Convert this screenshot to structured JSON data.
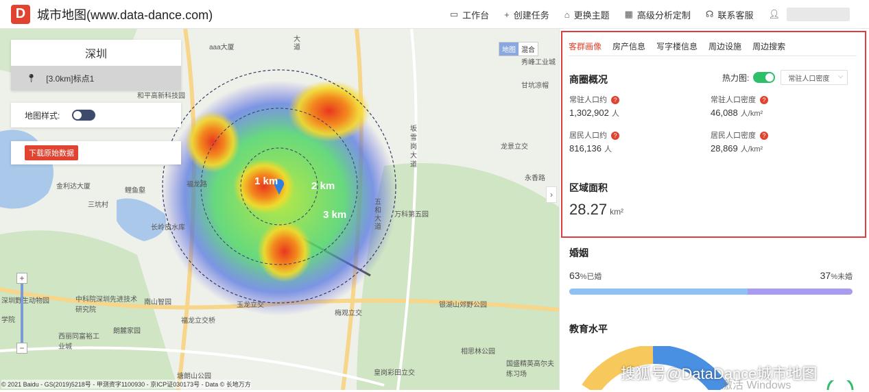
{
  "app": {
    "logo_letter": "D",
    "title": "城市地图(www.data-dance.com)"
  },
  "nav": [
    {
      "icon": "monitor-icon",
      "glyph": "▭",
      "label": "工作台"
    },
    {
      "icon": "plus-icon",
      "glyph": "+",
      "label": "创建任务"
    },
    {
      "icon": "shirt-icon",
      "glyph": "⌂",
      "label": "更换主题"
    },
    {
      "icon": "calendar-icon",
      "glyph": "▦",
      "label": "高级分析定制"
    },
    {
      "icon": "headset-icon",
      "glyph": "☊",
      "label": "联系客服"
    }
  ],
  "map": {
    "city": "深圳",
    "marker_label": "[3.0km]标点1",
    "style_label": "地图样式:",
    "download_label": "下载原始数据",
    "maptype": [
      "地图",
      "混合"
    ],
    "zoom_in": "+",
    "zoom_out": "−",
    "collapse": "›",
    "rings": [
      "1 km",
      "2 km",
      "3 km"
    ],
    "copyright": "© 2021 Baidu - GS(2019)5218号 - 甲测资字1100930 - 京ICP证030173号 - Data © 长地万方",
    "labels": [
      "aaa大厦",
      "金利达大厦",
      "鲤鱼壑",
      "三坑村",
      "长岭皮水库",
      "和平高新科技园",
      "福龙路",
      "深圳野生动物园",
      "中科院深圳先进技术研究院",
      "南山智园",
      "西丽同富裕工业城",
      "朗麓家园",
      "塘朗山公园",
      "福龙立交桥",
      "玉龙立交",
      "梅观立交",
      "银湖山郊野公园",
      "相思林公园",
      "皇岗彩田立交",
      "坂雪岗大道",
      "龙景立交",
      "永香路",
      "万科第五园",
      "秀峰工业城",
      "甘坑凉帽",
      "五和大道",
      "国盛精英高尔夫练习场",
      "大道",
      "学院"
    ]
  },
  "panel": {
    "tabs": [
      "客群画像",
      "房产信息",
      "写字楼信息",
      "周边设施",
      "周边搜索"
    ],
    "active_tab": 0,
    "business": {
      "title": "商圈概况",
      "heatmap_label": "热力图:",
      "heatmap_select": "常驻人口密度",
      "stats": [
        {
          "label": "常驻人口约",
          "value": "1,302,902",
          "unit": "人"
        },
        {
          "label": "常驻人口密度",
          "value": "46,088",
          "unit": "人/km²"
        },
        {
          "label": "居民人口约",
          "value": "816,136",
          "unit": "人"
        },
        {
          "label": "居民人口密度",
          "value": "28,869",
          "unit": "人/km²"
        }
      ]
    },
    "area": {
      "title": "区域面积",
      "value": "28.27",
      "unit": "km²"
    },
    "marriage": {
      "title": "婚姻",
      "married_value": "63",
      "married_label": "%已婚",
      "single_value": "37",
      "single_label": "%未婚",
      "married_fraction": 0.63
    },
    "education": {
      "title": "教育水平"
    }
  },
  "watermark": "搜狐号@DataDance城市地图",
  "os_watermark": "激活 Windows",
  "colors": {
    "brand": "#e0432f",
    "married": "#8ec2f5",
    "single": "#a79cf0",
    "toggle_on": "#2dbf6a",
    "highlight_border": "#e23b3b"
  }
}
